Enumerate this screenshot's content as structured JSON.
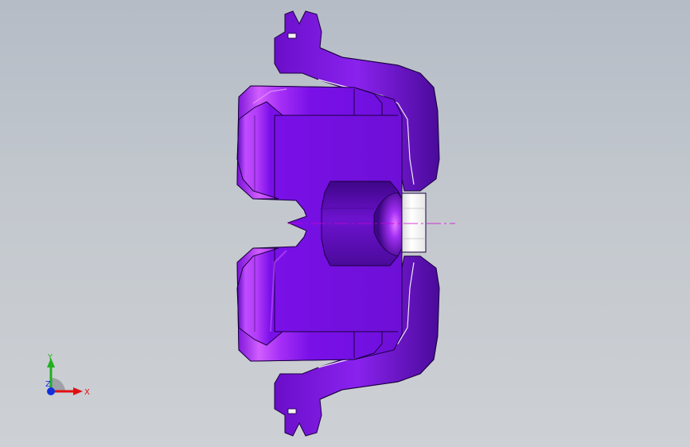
{
  "viewport": {
    "background_top": "#b5bcc6",
    "background_bottom": "#cdd0d4"
  },
  "model": {
    "color": "#7a10e8",
    "highlight_color": "#d66cff",
    "shadow_color": "#3e0687",
    "insert_color": "#f4f4f4",
    "centerline_color": "#d000d0"
  },
  "triad": {
    "x_label": "X",
    "y_label": "Y",
    "z_label": "Z",
    "x_color": "#e01010",
    "y_color": "#20b020",
    "z_color": "#1030e0"
  }
}
